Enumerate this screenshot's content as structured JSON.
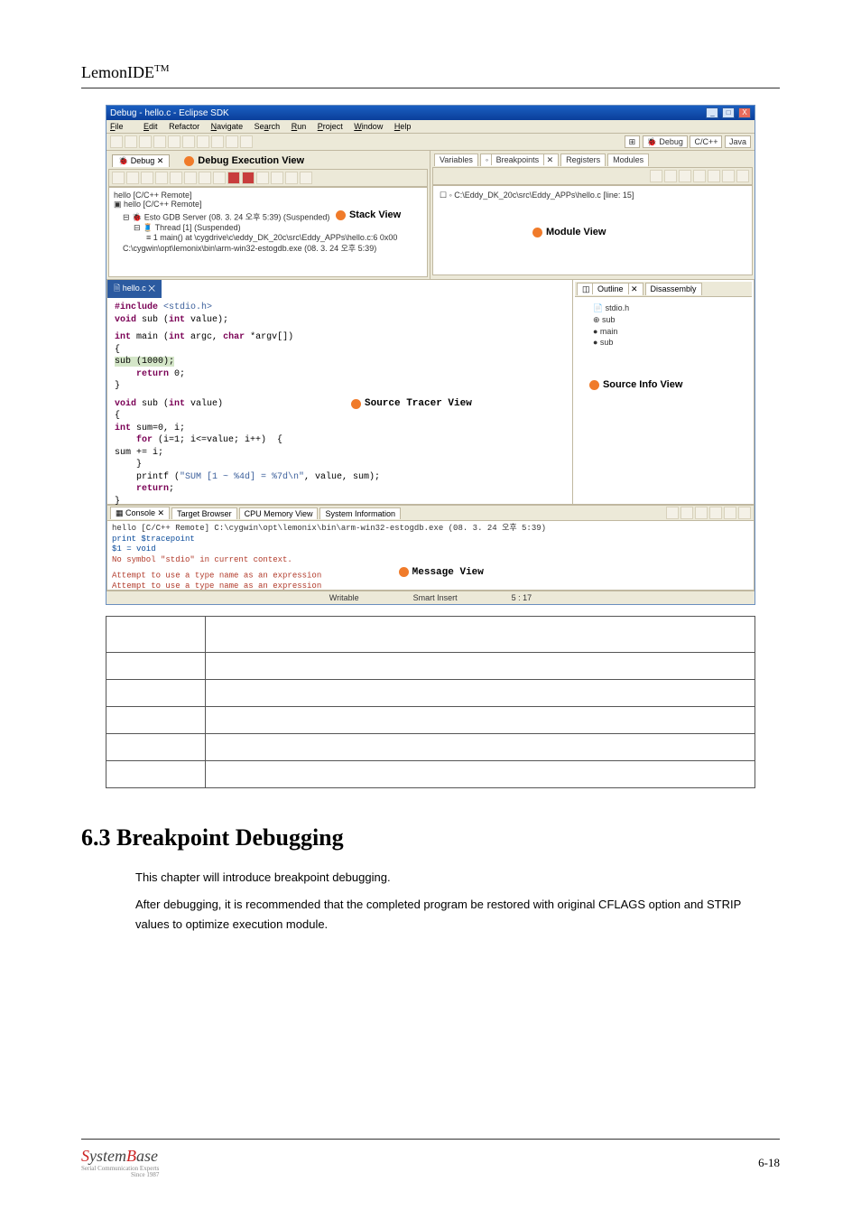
{
  "doc": {
    "header": "LemonIDE",
    "tm": "TM",
    "page_number": "6-18"
  },
  "section": {
    "heading": "6.3 Breakpoint Debugging",
    "p1": "This chapter will introduce breakpoint debugging.",
    "p2": "After debugging, it is recommended that the completed program be restored with original CFLAGS option and STRIP values to optimize execution module."
  },
  "logo": {
    "brand1": "S",
    "brand2": "ystem",
    "brand3": "B",
    "brand4": "ase",
    "tag1": "Serial Communication Experts",
    "tag2": "Since 1987"
  },
  "ide": {
    "title": "Debug - hello.c - Eclipse SDK",
    "menu": {
      "file": "File",
      "edit": "Edit",
      "refactor": "Refactor",
      "navigate": "Navigate",
      "search": "Search",
      "run": "Run",
      "project": "Project",
      "window": "Window",
      "help": "Help"
    },
    "persp": {
      "debug": "Debug",
      "cpp": "C/C++",
      "java": "Java"
    },
    "debug_tab": "Debug",
    "callouts": {
      "debug_exec": "Debug Execution View",
      "stack": "Stack View",
      "module": "Module View",
      "source_tracer": "Source Tracer View",
      "source_info": "Source Info View",
      "message": "Message View"
    },
    "vars_tabs": {
      "variables": "Variables",
      "breakpoints": "Breakpoints",
      "registers": "Registers",
      "modules": "Modules"
    },
    "module_line": "C:\\Eddy_DK_20c\\src\\Eddy_APPs\\hello.c [line: 15]",
    "stack": {
      "l1": "hello [C/C++ Remote]",
      "l2": "hello [C/C++ Remote]",
      "l3": "Esto GDB Server (08. 3. 24 오후 5:39) (Suspended)",
      "l4": "Thread [1] (Suspended)",
      "l5": "1 main() at \\cygdrive\\c\\eddy_DK_20c\\src\\Eddy_APPs\\hello.c:6 0x00",
      "l6": "C:\\cygwin\\opt\\lemonix\\bin\\arm-win32-estogdb.exe (08. 3. 24 오후 5:39)"
    },
    "code_tab": "hello.c",
    "code": {
      "l1a": "#include ",
      "l1b": "<stdio.h>",
      "l2": "void sub (int value);",
      "l3": "int main (int argc, char *argv[])",
      "l4": "{",
      "l5": "    sub (1000);",
      "l6": "    return 0;",
      "l7": "}",
      "l8": "void sub (int value)",
      "l9": "{",
      "l10": "int sum=0, i;",
      "l11": "    for (i=1; i<=value; i++)  {",
      "l12": "        sum += i;",
      "l13": "    }",
      "l14": "    printf (\"SUM [1 ~ %4d] = %7d\\n\", value, sum);",
      "l15": "    return;",
      "l16": "}"
    },
    "outline_tabs": {
      "outline": "Outline",
      "disassembly": "Disassembly"
    },
    "outline_items": {
      "i1": "stdio.h",
      "i2": "sub",
      "i3": "main",
      "i4": "sub"
    },
    "console_tabs": {
      "console": "Console",
      "target": "Target Browser",
      "cpu": "CPU Memory View",
      "sys": "System Information"
    },
    "console": {
      "header": "hello [C/C++ Remote] C:\\cygwin\\opt\\lemonix\\bin\\arm-win32-estogdb.exe (08. 3. 24 오후 5:39)",
      "l1": "print  $tracepoint",
      "l2": "$1 = void",
      "l3": "No symbol \"stdio\" in current context.",
      "l4": "Attempt to use a type name as an expression",
      "l5": "Attempt to use a type name as an expression"
    },
    "status": {
      "writable": "Writable",
      "smart": "Smart Insert",
      "pos": "5 : 17"
    }
  }
}
